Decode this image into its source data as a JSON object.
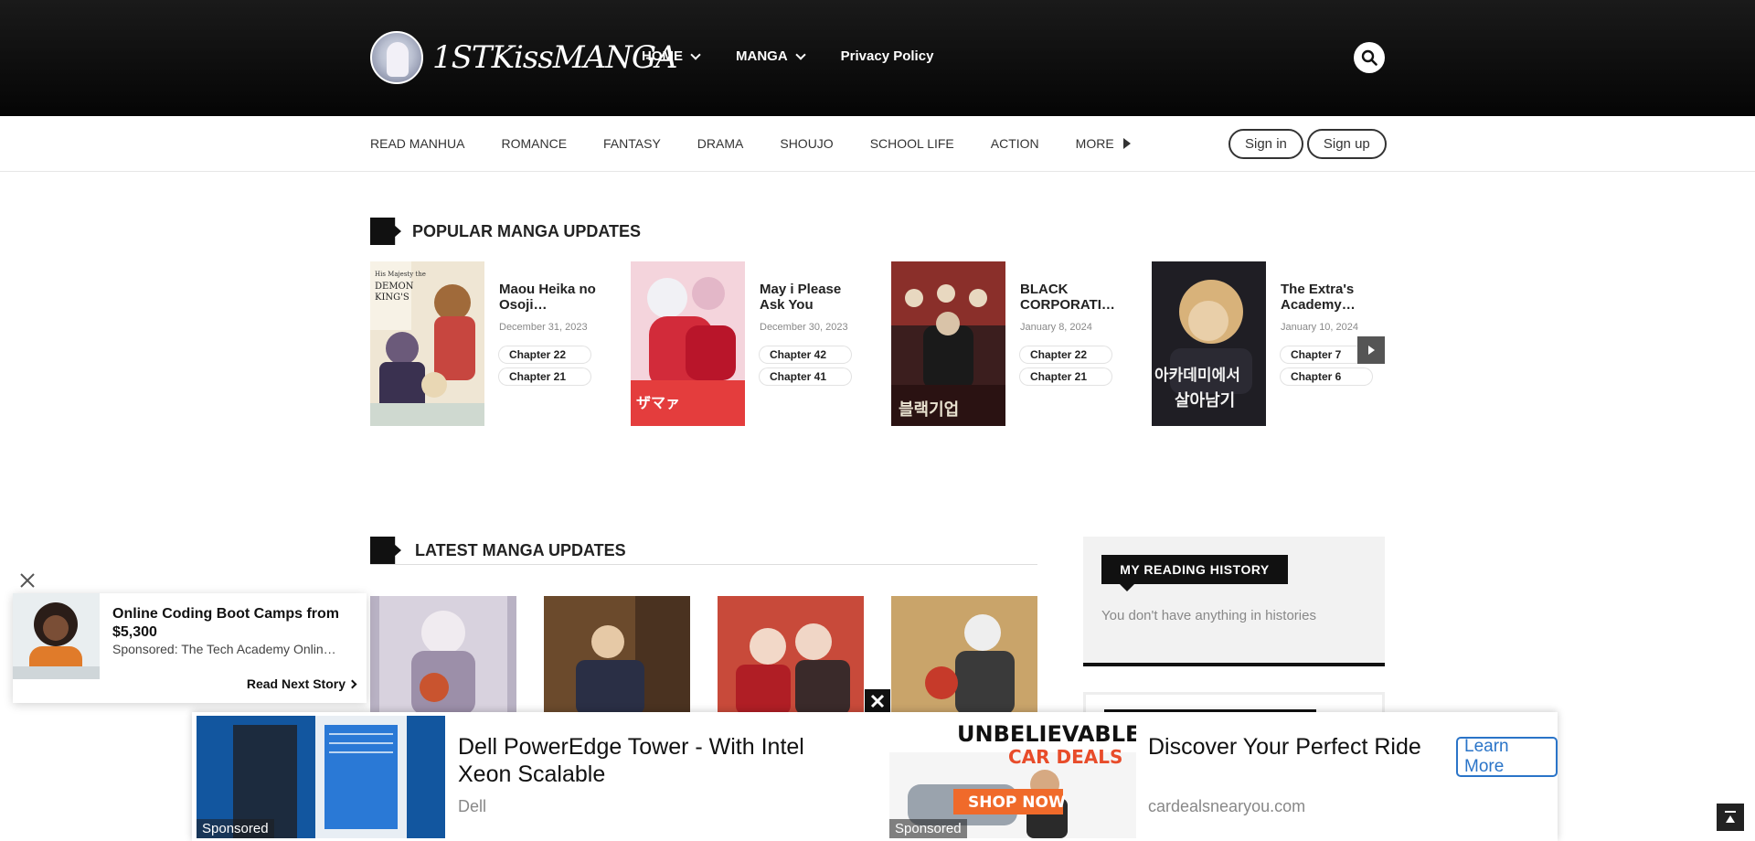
{
  "header": {
    "logo_text": "1STKissMANGA",
    "nav": [
      {
        "label": "HOME"
      },
      {
        "label": "MANGA"
      },
      {
        "label": "Privacy Policy"
      }
    ]
  },
  "subnav": {
    "links": [
      "READ MANHUA",
      "ROMANCE",
      "FANTASY",
      "DRAMA",
      "SHOUJO",
      "SCHOOL LIFE",
      "ACTION"
    ],
    "more_label": "MORE",
    "sign_in": "Sign in",
    "sign_up": "Sign up"
  },
  "popular": {
    "title": "POPULAR MANGA UPDATES",
    "items": [
      {
        "title": "Maou Heika no Osoji…",
        "date": "December 31, 2023",
        "chapters": [
          "Chapter 22",
          "Chapter 21"
        ]
      },
      {
        "title": "May i Please Ask You Just…",
        "date": "December 30, 2023",
        "chapters": [
          "Chapter 42",
          "Chapter 41"
        ]
      },
      {
        "title": "BLACK CORPORATI…",
        "date": "January 8, 2024",
        "chapters": [
          "Chapter 22",
          "Chapter 21"
        ]
      },
      {
        "title": "The Extra's Academy…",
        "date": "January 10, 2024",
        "chapters": [
          "Chapter 7",
          "Chapter 6"
        ]
      }
    ]
  },
  "latest": {
    "title": "LATEST MANGA UPDATES"
  },
  "sidebar": {
    "history_title": "MY READING HISTORY",
    "history_empty": "You don't have anything in histories"
  },
  "story_widget": {
    "title": "Online Coding Boot Camps from $5,300",
    "sponsor": "Sponsored: The Tech Academy Onlin…",
    "next_label": "Read Next Story"
  },
  "ads": [
    {
      "title": "Dell PowerEdge Tower - With Intel Xeon Scalable",
      "source": "Dell",
      "sponsored": "Sponsored",
      "image_text": ""
    },
    {
      "title": "Discover Your Perfect Ride",
      "source": "cardealsnearyou.com",
      "sponsored": "Sponsored",
      "image_text_1": "UNBELIEVABLE",
      "image_text_2": "CAR DEALS",
      "image_cta": "SHOP NOW",
      "cta": "Learn More"
    }
  ],
  "colors": {
    "header_bg": "#0d0d0d",
    "accent_blue": "#2a74c8",
    "text_dark": "#222222"
  }
}
